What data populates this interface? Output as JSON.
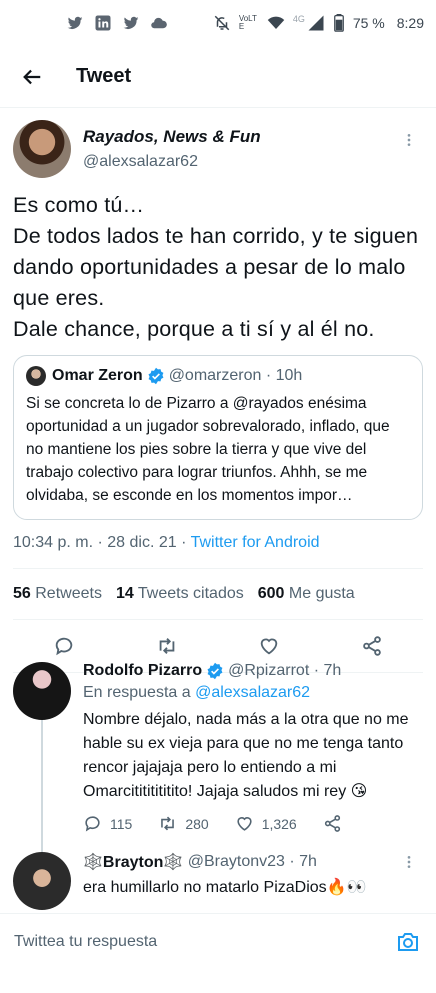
{
  "statusbar": {
    "left_icons": [
      "twitter-icon",
      "linkedin-icon",
      "twitter-icon",
      "cloud-icon"
    ],
    "right_icons": [
      "mute-icon",
      "volte-icon",
      "wifi-icon",
      "signal-icon",
      "battery-icon"
    ],
    "volte": "VoLTE",
    "network": "4G",
    "battery": "75 %",
    "time": "8:29"
  },
  "header": {
    "title": "Tweet"
  },
  "tweet": {
    "display_name": "Rayados, News & Fun",
    "handle": "@alexsalazar62",
    "text_lines": [
      "Es como tú…",
      "De todos lados te han corrido, y te siguen dando oportunidades a pesar de lo malo que eres.",
      "Dale chance,  porque a ti sí y al él no."
    ],
    "quote": {
      "name": "Omar Zeron",
      "handle": "@omarzeron",
      "time": "10h",
      "text": "Si se concreta lo de Pizarro a @rayados enésima oportunidad a un jugador sobrevalorado, inflado, que no mantiene los pies sobre la tierra y que vive del trabajo colectivo para lograr triunfos. Ahhh, se me olvidaba, se esconde en los momentos impor…"
    },
    "timestamp": "10:34 p. m. · 28 dic. 21 · ",
    "source": "Twitter for Android",
    "stats": {
      "retweets_count": "56",
      "retweets_label": "Retweets",
      "quotes_count": "14",
      "quotes_label": "Tweets citados",
      "likes_count": "600",
      "likes_label": "Me gusta"
    }
  },
  "replies": [
    {
      "name": "Rodolfo Pizarro",
      "handle": "@Rpizarrot",
      "time": "7h",
      "reply_prefix": "En respuesta a ",
      "reply_to": "@alexsalazar62",
      "text": "Nombre déjalo, nada más a la otra que no me hable su ex vieja para que no me tenga tanto rencor jajajaja pero lo entiendo a mi Omarcitititititito! Jajaja saludos mi rey 😘",
      "replies_count": "115",
      "retweets_count": "280",
      "likes_count": "1,326"
    },
    {
      "name": "🕸️Brayton🕸️",
      "handle": "@Braytonv23",
      "time": "7h",
      "text": "era humillarlo no matarlo PizaDios🔥👀"
    }
  ],
  "composer": {
    "placeholder": "Twittea tu respuesta"
  }
}
